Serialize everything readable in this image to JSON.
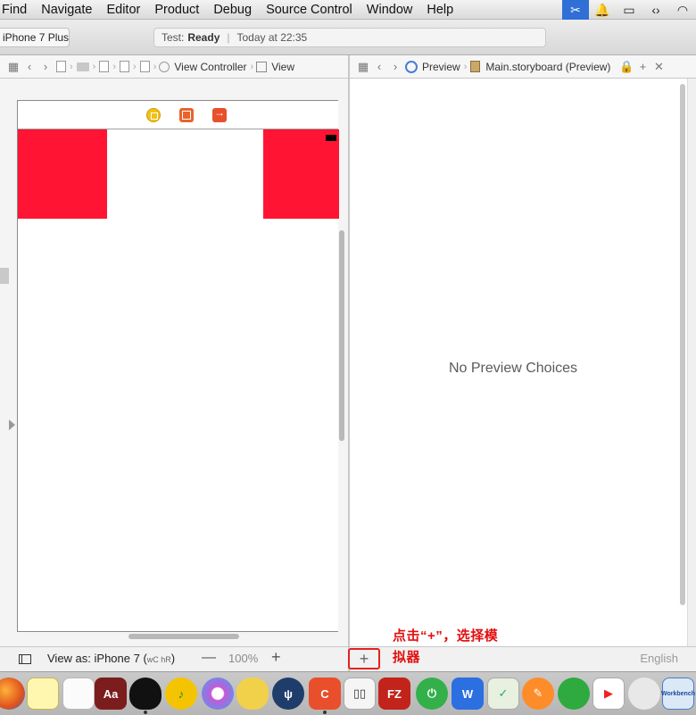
{
  "menubar": {
    "items": [
      "Find",
      "Navigate",
      "Editor",
      "Product",
      "Debug",
      "Source Control",
      "Window",
      "Help"
    ]
  },
  "toolbar": {
    "scheme": "iPhone 7 Plus",
    "activity_prefix": "Test:",
    "activity_status": "Ready",
    "activity_time": "Today at 22:35"
  },
  "left_jumpbar": {
    "view_controller": "View Controller",
    "view": "View"
  },
  "right_jumpbar": {
    "preview": "Preview",
    "file": "Main.storyboard (Preview)"
  },
  "preview": {
    "empty_message": "No Preview Choices"
  },
  "bottom_left": {
    "view_as": "View as: iPhone 7 (",
    "size_class": "wC hR",
    "view_as_close": ")",
    "zoom_minus": "—",
    "zoom": "100%",
    "zoom_plus": "+"
  },
  "bottom_right": {
    "add_label": "+",
    "annotation_line1": "点击“+”，选择模",
    "annotation_line2": "拟器",
    "language": "English"
  },
  "colors": {
    "red_view": "#ff1533",
    "annotation": "#e30f0f",
    "accent": "#2f6fd6"
  },
  "dock": {
    "apps": [
      "firefox",
      "notes",
      "textedit",
      "dictionary",
      "qq",
      "music-player",
      "itunes",
      "squirrel",
      "sourcetree",
      "clion",
      "reader",
      "filezilla",
      "power",
      "wps",
      "maps-app",
      "pencil",
      "evernote",
      "video-player",
      "scripteditor",
      "mysql-workbench"
    ]
  }
}
